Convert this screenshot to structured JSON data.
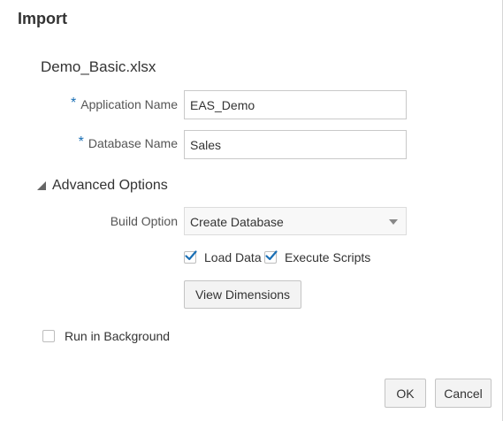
{
  "dialog": {
    "title": "Import",
    "file_name": "Demo_Basic.xlsx"
  },
  "form": {
    "application_name": {
      "required_marker": "*",
      "label": "Application Name",
      "value": "EAS_Demo"
    },
    "database_name": {
      "required_marker": "*",
      "label": "Database Name",
      "value": "Sales"
    }
  },
  "advanced": {
    "toggle_label": "Advanced Options",
    "expanded": true,
    "build_option": {
      "label": "Build Option",
      "selected": "Create Database"
    },
    "load_data": {
      "label": "Load Data",
      "checked": true
    },
    "execute_scripts": {
      "label": "Execute Scripts",
      "checked": true
    },
    "view_dimensions_label": "View Dimensions"
  },
  "run_in_background": {
    "label": "Run in Background",
    "checked": false
  },
  "footer": {
    "ok_label": "OK",
    "cancel_label": "Cancel"
  },
  "colors": {
    "required_marker": "#1a6fb5",
    "checkmark": "#1a6fb5",
    "button_bg": "#f3f3f3",
    "select_bg": "#f8f8f8"
  },
  "icons": {
    "advanced_toggle": "triangle-expanded-icon",
    "select_arrow": "chevron-down-icon",
    "checkbox_checked": "checkmark-icon"
  }
}
